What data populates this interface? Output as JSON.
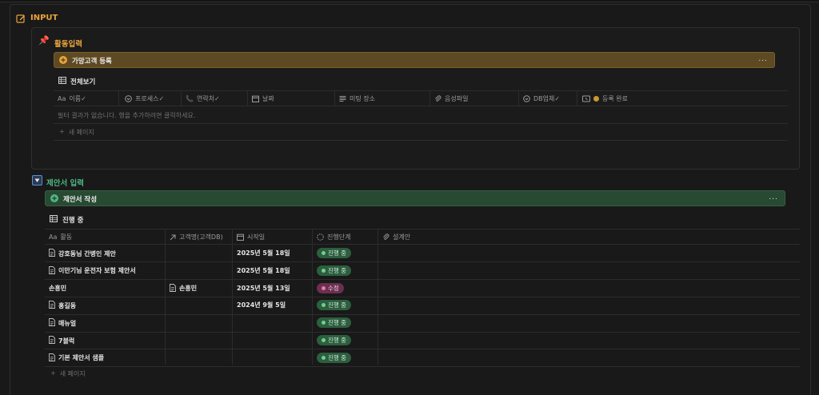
{
  "page": {
    "title": "INPUT"
  },
  "activity_section": {
    "title": "활동입력",
    "callout_label": "가망고객 등록",
    "callout_more": "...",
    "view_title": "전체보기",
    "columns": [
      {
        "icon": "text-icon",
        "label": "이름✓"
      },
      {
        "icon": "status-icon",
        "label": "프로세스✓"
      },
      {
        "icon": "phone-icon",
        "label": "연락처✓"
      },
      {
        "icon": "calendar-icon",
        "label": "날짜"
      },
      {
        "icon": "text-lines-icon",
        "label": "미팅 장소"
      },
      {
        "icon": "paperclip-icon",
        "label": "음성파일"
      },
      {
        "icon": "status-icon",
        "label": "DB업체✓"
      },
      {
        "icon": "button-icon",
        "label": "등록 완료"
      }
    ],
    "empty_text": "필터 결과가 없습니다. 행을 추가하려면 클릭하세요.",
    "new_page": "새 페이지"
  },
  "proposal_section": {
    "title": "제안서 입력",
    "callout_label": "제안서 작성",
    "callout_more": "...",
    "view_title": "진행 중",
    "columns": [
      {
        "icon": "text-icon",
        "label": "활동"
      },
      {
        "icon": "relation-arrow-icon",
        "label": "고객명(고객DB)"
      },
      {
        "icon": "calendar-icon",
        "label": "시작일"
      },
      {
        "icon": "status-dashed-icon",
        "label": "진행단계"
      },
      {
        "icon": "paperclip-icon",
        "label": "설계안"
      }
    ],
    "rows": [
      {
        "name": "강호동님 간병인 제안",
        "doc_icon": true,
        "customer": "",
        "date": "2025년 5월 18일",
        "status": "진행 중",
        "status_color": "green"
      },
      {
        "name": "이만기님 운전자 보험 제안서",
        "doc_icon": true,
        "customer": "",
        "date": "2025년 5월 18일",
        "status": "진행 중",
        "status_color": "green"
      },
      {
        "name": "손흥민",
        "doc_icon": false,
        "customer": "손흥민",
        "date": "2025년 5월 13일",
        "status": "수정",
        "status_color": "pink"
      },
      {
        "name": "홍길동",
        "doc_icon": true,
        "customer": "",
        "date": "2024년 9월 5일",
        "status": "진행 중",
        "status_color": "green"
      },
      {
        "name": "매뉴얼",
        "doc_icon": true,
        "customer": "",
        "date": "",
        "status": "진행 중",
        "status_color": "green"
      },
      {
        "name": "7블럭",
        "doc_icon": true,
        "customer": "",
        "date": "",
        "status": "진행 중",
        "status_color": "green"
      },
      {
        "name": "기본 제안서 샘플",
        "doc_icon": true,
        "customer": "",
        "date": "",
        "status": "진행 중",
        "status_color": "green"
      }
    ],
    "new_page": "새 페이지"
  },
  "colors": {
    "accent_orange": "#e8a33d",
    "accent_green": "#4cb782",
    "gold_callout": "#5e4a22",
    "green_callout": "#284a33"
  }
}
